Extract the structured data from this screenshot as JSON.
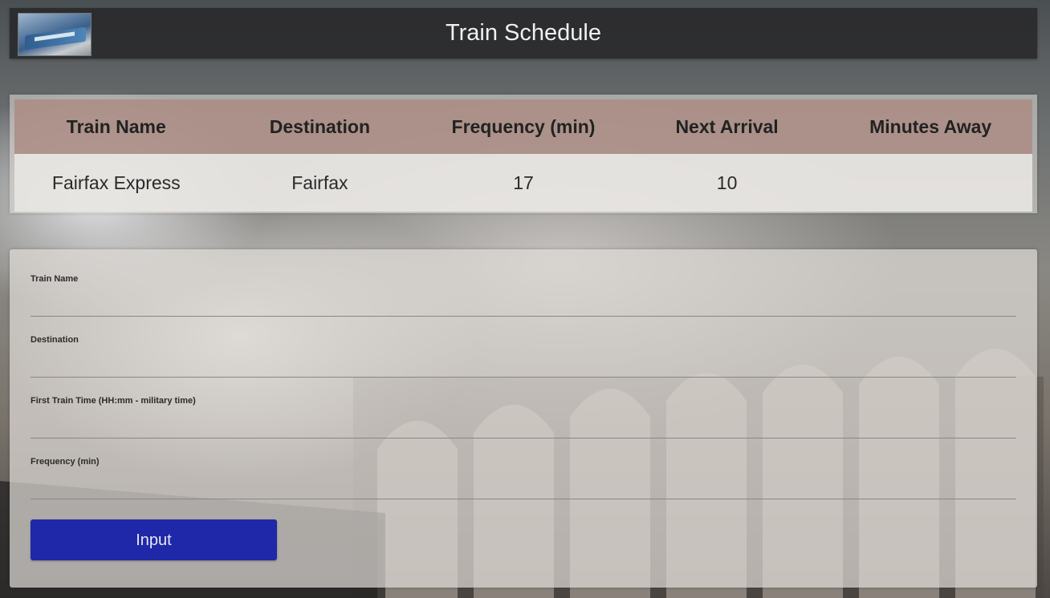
{
  "header": {
    "title": "Train Schedule",
    "logo_icon": "train-photo-icon"
  },
  "schedule": {
    "columns": [
      "Train Name",
      "Destination",
      "Frequency (min)",
      "Next Arrival",
      "Minutes Away"
    ],
    "rows": [
      [
        "Fairfax Express",
        "Fairfax",
        "17",
        "10",
        ""
      ]
    ]
  },
  "form": {
    "train_name_label": "Train Name",
    "destination_label": "Destination",
    "first_train_label": "First Train Time (HH:mm - military time)",
    "frequency_label": "Frequency (min)",
    "submit_label": "Input"
  },
  "colors": {
    "header_bg": "#28282a",
    "table_header_bg": "#aa8c84",
    "button_bg": "#1f28a8"
  }
}
